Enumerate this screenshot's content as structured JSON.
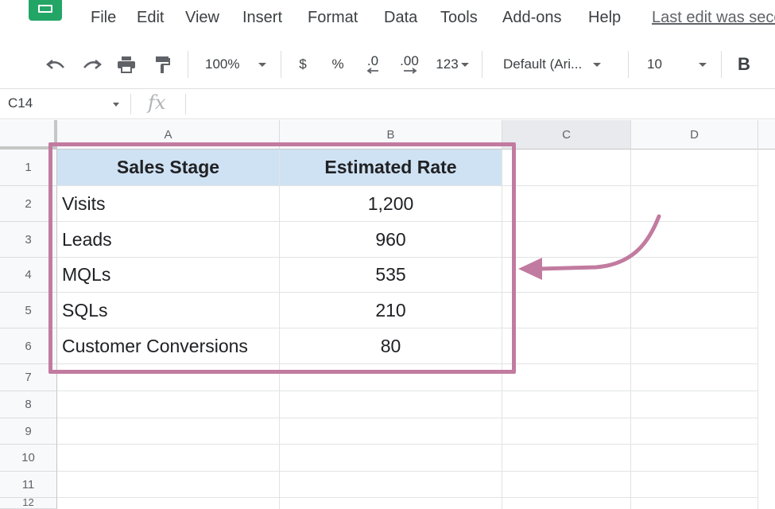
{
  "menubar": {
    "items": [
      "File",
      "Edit",
      "View",
      "Insert",
      "Format",
      "Data",
      "Tools",
      "Add-ons",
      "Help"
    ],
    "last_edit": "Last edit was seconds ago"
  },
  "toolbar": {
    "zoom": "100%",
    "currency": "$",
    "percent": "%",
    "decrease_decimal": ".0",
    "increase_decimal": ".00",
    "more_formats": "123",
    "font": "Default (Ari...",
    "font_size": "10",
    "bold": "B"
  },
  "formula_bar": {
    "cell_ref": "C14",
    "fx": "fx",
    "value": ""
  },
  "sheet": {
    "columns": [
      "A",
      "B",
      "C",
      "D"
    ],
    "rows": [
      "1",
      "2",
      "3",
      "4",
      "5",
      "6",
      "7",
      "8",
      "9",
      "10",
      "11",
      "12"
    ],
    "table": {
      "headers": [
        "Sales Stage",
        "Estimated Rate"
      ],
      "rows": [
        [
          "Visits",
          "1,200"
        ],
        [
          "Leads",
          "960"
        ],
        [
          "MQLs",
          "535"
        ],
        [
          "SQLs",
          "210"
        ],
        [
          "Customer Conversions",
          "80"
        ]
      ]
    },
    "header_fill": "#cfe2f3"
  },
  "annotation": {
    "color": "#c27ba0"
  },
  "colors": {
    "brand": "#23a566",
    "selected_column_header": "#e8eaed"
  }
}
